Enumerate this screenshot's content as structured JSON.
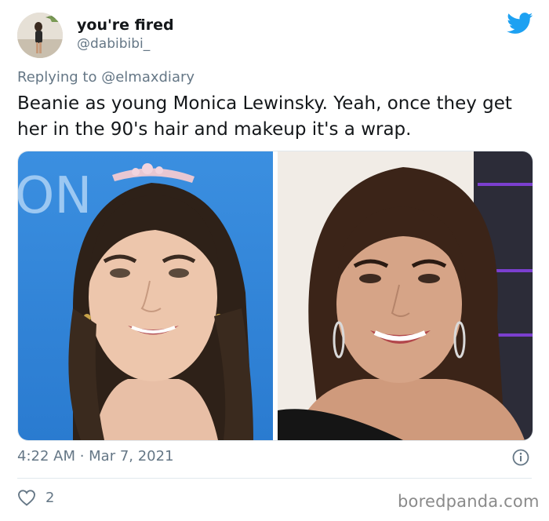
{
  "author": {
    "display_name": "you're fired",
    "handle": "@dabibibi_"
  },
  "reply": {
    "prefix": "Replying to",
    "mention": "@elmaxdiary"
  },
  "tweet": {
    "text": "Beanie as young Monica Lewinsky. Yeah, once they get her in the 90's hair and makeup it's a wrap."
  },
  "media": {
    "left_backdrop_text": "ON"
  },
  "meta": {
    "timestamp": "4:22 AM · Mar 7, 2021",
    "likes": "2"
  },
  "watermark": "boredpanda.com",
  "colors": {
    "twitter_blue": "#1da1f2",
    "muted": "#657786",
    "left_backdrop": "#2f87d9"
  },
  "icons": [
    "twitter-bird-icon",
    "info-icon",
    "heart-icon"
  ]
}
